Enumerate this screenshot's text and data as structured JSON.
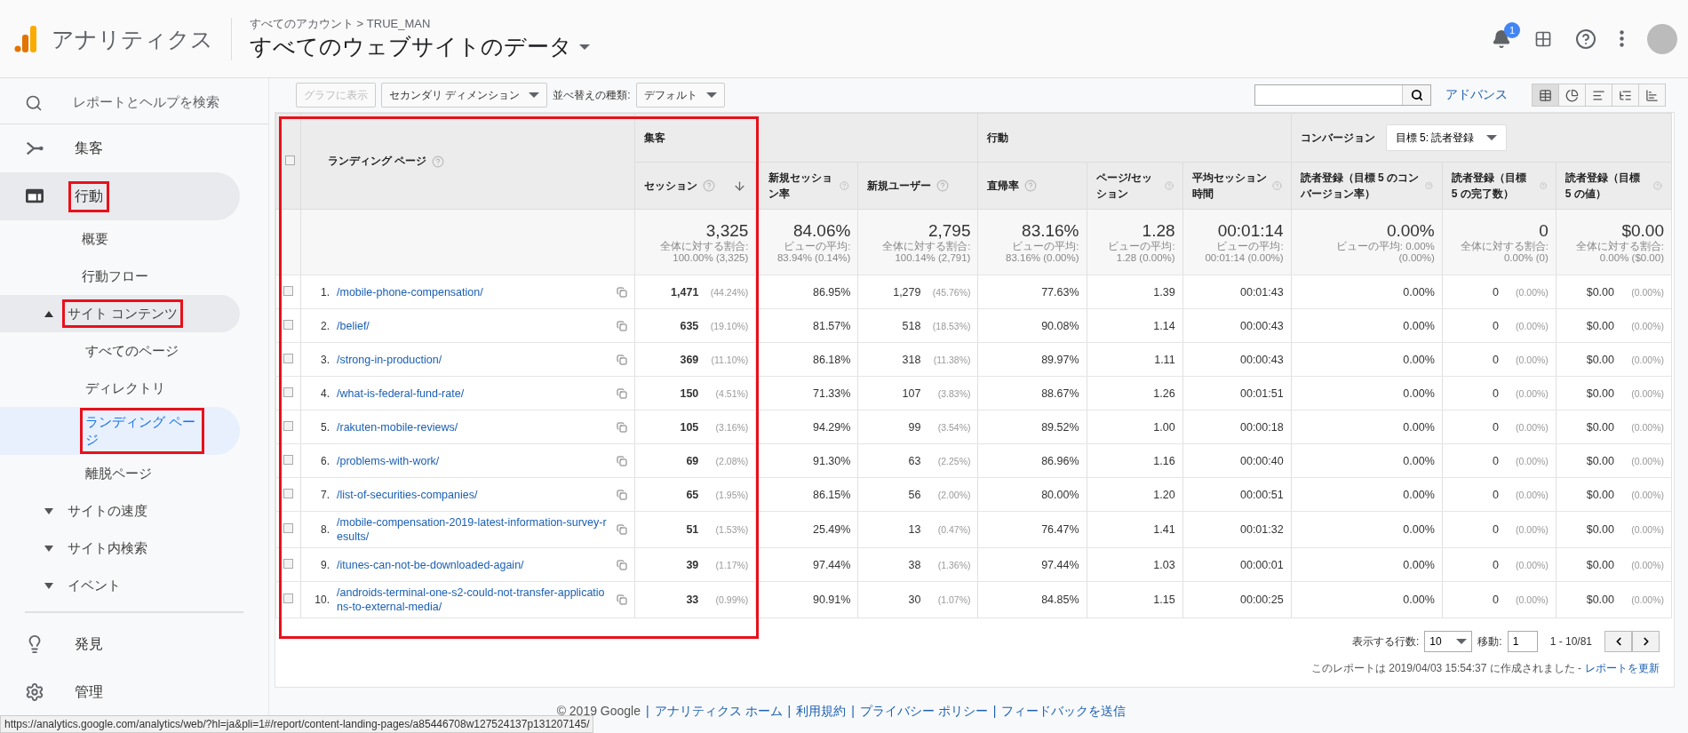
{
  "header": {
    "app_name": "アナリティクス",
    "breadcrumb": "すべてのアカウント > TRUE_MAN",
    "property": "すべてのウェブサイトのデータ",
    "notification_count": "1"
  },
  "sidebar": {
    "search": "レポートとヘルプを検索",
    "items": [
      {
        "label": "集客",
        "expanded": false,
        "annotated": false
      },
      {
        "label": "行動",
        "expanded": true,
        "annotated": true,
        "children": [
          {
            "label": "概要",
            "selected": false,
            "annotated": false
          },
          {
            "label": "行動フロー",
            "selected": false,
            "annotated": false
          },
          {
            "label": "サイト コンテンツ",
            "expanded": true,
            "annotated": true,
            "children": [
              {
                "label": "すべてのページ",
                "selected": false,
                "annotated": false
              },
              {
                "label": "ディレクトリ",
                "selected": false,
                "annotated": false
              },
              {
                "label": "ランディング ページ",
                "selected": true,
                "annotated": true
              },
              {
                "label": "離脱ページ",
                "selected": false,
                "annotated": false
              }
            ]
          },
          {
            "label": "サイトの速度",
            "expanded": false,
            "annotated": false
          },
          {
            "label": "サイト内検索",
            "expanded": false,
            "annotated": false
          },
          {
            "label": "イベント",
            "expanded": false,
            "annotated": false
          }
        ]
      }
    ],
    "bottom": [
      "発見",
      "管理"
    ]
  },
  "toolbar": {
    "chart_button": "グラフに表示",
    "chart_button_disabled": true,
    "secondary": "セカンダリ ディメンション",
    "sort_label": "並べ替えの種類:",
    "sort_value": "デフォルト",
    "advanced": "アドバンス",
    "views": [
      {
        "selected": true
      },
      {
        "selected": false
      },
      {
        "selected": false
      },
      {
        "selected": false
      },
      {
        "selected": false
      }
    ]
  },
  "table": {
    "annotated": true,
    "all_checked": false,
    "dimension": "ランディング ページ",
    "groups": [
      {
        "label": "集客"
      },
      {
        "label": "行動"
      },
      {
        "label": "コンバージョン",
        "goal": "目標 5: 読者登録"
      }
    ],
    "columns": [
      {
        "label": "セッション",
        "sorted": true
      },
      {
        "label": "新規セッション率",
        "sorted": false
      },
      {
        "label": "新規ユーザー",
        "sorted": false
      },
      {
        "label": "直帰率",
        "sorted": false
      },
      {
        "label": "ページ/セッション",
        "sorted": false
      },
      {
        "label": "平均セッション時間",
        "sorted": false
      },
      {
        "label": "読者登録（目標 5 のコンバージョン率）",
        "sorted": false
      },
      {
        "label": "読者登録（目標 5 の完了数）",
        "sorted": false
      },
      {
        "label": "読者登録（目標 5 の値）",
        "sorted": false
      }
    ],
    "totals": [
      {
        "value": "3,325",
        "note": "全体に対する割合: 100.00% (3,325)"
      },
      {
        "value": "84.06%",
        "note": "ビューの平均: 83.94% (0.14%)"
      },
      {
        "value": "2,795",
        "note": "全体に対する割合: 100.14% (2,791)"
      },
      {
        "value": "83.16%",
        "note": "ビューの平均: 83.16% (0.00%)"
      },
      {
        "value": "1.28",
        "note": "ビューの平均: 1.28 (0.00%)"
      },
      {
        "value": "00:01:14",
        "note": "ビューの平均: 00:01:14 (0.00%)"
      },
      {
        "value": "0.00%",
        "note": "ビューの平均: 0.00% (0.00%)"
      },
      {
        "value": "0",
        "note": "全体に対する割合: 0.00% (0)"
      },
      {
        "value": "$0.00",
        "note": "全体に対する割合: 0.00% ($0.00)"
      }
    ],
    "rows": [
      {
        "number": "1.",
        "checked": false,
        "page": "/mobile-phone-compensation/",
        "cells": [
          {
            "value": "1,471",
            "pct": "(44.24%)"
          },
          {
            "value": "86.95%"
          },
          {
            "value": "1,279",
            "pct": "(45.76%)"
          },
          {
            "value": "77.63%"
          },
          {
            "value": "1.39"
          },
          {
            "value": "00:01:43"
          },
          {
            "value": "0.00%"
          },
          {
            "value": "0",
            "pct": "(0.00%)"
          },
          {
            "value": "$0.00",
            "pct": "(0.00%)"
          }
        ]
      },
      {
        "number": "2.",
        "checked": false,
        "page": "/belief/",
        "cells": [
          {
            "value": "635",
            "pct": "(19.10%)"
          },
          {
            "value": "81.57%"
          },
          {
            "value": "518",
            "pct": "(18.53%)"
          },
          {
            "value": "90.08%"
          },
          {
            "value": "1.14"
          },
          {
            "value": "00:00:43"
          },
          {
            "value": "0.00%"
          },
          {
            "value": "0",
            "pct": "(0.00%)"
          },
          {
            "value": "$0.00",
            "pct": "(0.00%)"
          }
        ]
      },
      {
        "number": "3.",
        "checked": false,
        "page": "/strong-in-production/",
        "cells": [
          {
            "value": "369",
            "pct": "(11.10%)"
          },
          {
            "value": "86.18%"
          },
          {
            "value": "318",
            "pct": "(11.38%)"
          },
          {
            "value": "89.97%"
          },
          {
            "value": "1.11"
          },
          {
            "value": "00:00:43"
          },
          {
            "value": "0.00%"
          },
          {
            "value": "0",
            "pct": "(0.00%)"
          },
          {
            "value": "$0.00",
            "pct": "(0.00%)"
          }
        ]
      },
      {
        "number": "4.",
        "checked": false,
        "page": "/what-is-federal-fund-rate/",
        "cells": [
          {
            "value": "150",
            "pct": "(4.51%)"
          },
          {
            "value": "71.33%"
          },
          {
            "value": "107",
            "pct": "(3.83%)"
          },
          {
            "value": "88.67%"
          },
          {
            "value": "1.26"
          },
          {
            "value": "00:01:51"
          },
          {
            "value": "0.00%"
          },
          {
            "value": "0",
            "pct": "(0.00%)"
          },
          {
            "value": "$0.00",
            "pct": "(0.00%)"
          }
        ]
      },
      {
        "number": "5.",
        "checked": false,
        "page": "/rakuten-mobile-reviews/",
        "cells": [
          {
            "value": "105",
            "pct": "(3.16%)"
          },
          {
            "value": "94.29%"
          },
          {
            "value": "99",
            "pct": "(3.54%)"
          },
          {
            "value": "89.52%"
          },
          {
            "value": "1.00"
          },
          {
            "value": "00:00:18"
          },
          {
            "value": "0.00%"
          },
          {
            "value": "0",
            "pct": "(0.00%)"
          },
          {
            "value": "$0.00",
            "pct": "(0.00%)"
          }
        ]
      },
      {
        "number": "6.",
        "checked": false,
        "page": "/problems-with-work/",
        "cells": [
          {
            "value": "69",
            "pct": "(2.08%)"
          },
          {
            "value": "91.30%"
          },
          {
            "value": "63",
            "pct": "(2.25%)"
          },
          {
            "value": "86.96%"
          },
          {
            "value": "1.16"
          },
          {
            "value": "00:00:40"
          },
          {
            "value": "0.00%"
          },
          {
            "value": "0",
            "pct": "(0.00%)"
          },
          {
            "value": "$0.00",
            "pct": "(0.00%)"
          }
        ]
      },
      {
        "number": "7.",
        "checked": false,
        "page": "/list-of-securities-companies/",
        "cells": [
          {
            "value": "65",
            "pct": "(1.95%)"
          },
          {
            "value": "86.15%"
          },
          {
            "value": "56",
            "pct": "(2.00%)"
          },
          {
            "value": "80.00%"
          },
          {
            "value": "1.20"
          },
          {
            "value": "00:00:51"
          },
          {
            "value": "0.00%"
          },
          {
            "value": "0",
            "pct": "(0.00%)"
          },
          {
            "value": "$0.00",
            "pct": "(0.00%)"
          }
        ]
      },
      {
        "number": "8.",
        "checked": false,
        "page": "/mobile-compensation-2019-latest-information-survey-results/",
        "cells": [
          {
            "value": "51",
            "pct": "(1.53%)"
          },
          {
            "value": "25.49%"
          },
          {
            "value": "13",
            "pct": "(0.47%)"
          },
          {
            "value": "76.47%"
          },
          {
            "value": "1.41"
          },
          {
            "value": "00:01:32"
          },
          {
            "value": "0.00%"
          },
          {
            "value": "0",
            "pct": "(0.00%)"
          },
          {
            "value": "$0.00",
            "pct": "(0.00%)"
          }
        ]
      },
      {
        "number": "9.",
        "checked": false,
        "page": "/itunes-can-not-be-downloaded-again/",
        "cells": [
          {
            "value": "39",
            "pct": "(1.17%)"
          },
          {
            "value": "97.44%"
          },
          {
            "value": "38",
            "pct": "(1.36%)"
          },
          {
            "value": "97.44%"
          },
          {
            "value": "1.03"
          },
          {
            "value": "00:00:01"
          },
          {
            "value": "0.00%"
          },
          {
            "value": "0",
            "pct": "(0.00%)"
          },
          {
            "value": "$0.00",
            "pct": "(0.00%)"
          }
        ]
      },
      {
        "number": "10.",
        "checked": false,
        "page": "/androids-terminal-one-s2-could-not-transfer-applications-to-external-media/",
        "cells": [
          {
            "value": "33",
            "pct": "(0.99%)"
          },
          {
            "value": "90.91%"
          },
          {
            "value": "30",
            "pct": "(1.07%)"
          },
          {
            "value": "84.85%"
          },
          {
            "value": "1.15"
          },
          {
            "value": "00:00:25"
          },
          {
            "value": "0.00%"
          },
          {
            "value": "0",
            "pct": "(0.00%)"
          },
          {
            "value": "$0.00",
            "pct": "(0.00%)"
          }
        ]
      }
    ]
  },
  "pagination": {
    "rows_label": "表示する行数:",
    "rows_value": "10",
    "goto_label": "移動:",
    "goto_value": "1",
    "range": "1 - 10/81"
  },
  "report_note": {
    "text": "このレポートは 2019/04/03 15:54:37 に作成されました -",
    "link": "レポートを更新"
  },
  "footer": {
    "copyright": "© 2019 Google",
    "separator": "|",
    "links": [
      "アナリティクス ホーム",
      "利用規約",
      "プライバシー ポリシー",
      "フィードバックを送信"
    ]
  },
  "status_url": "https://analytics.google.com/analytics/web/?hl=ja&pli=1#/report/content-landing-pages/a85446708w127524137p131207145/"
}
